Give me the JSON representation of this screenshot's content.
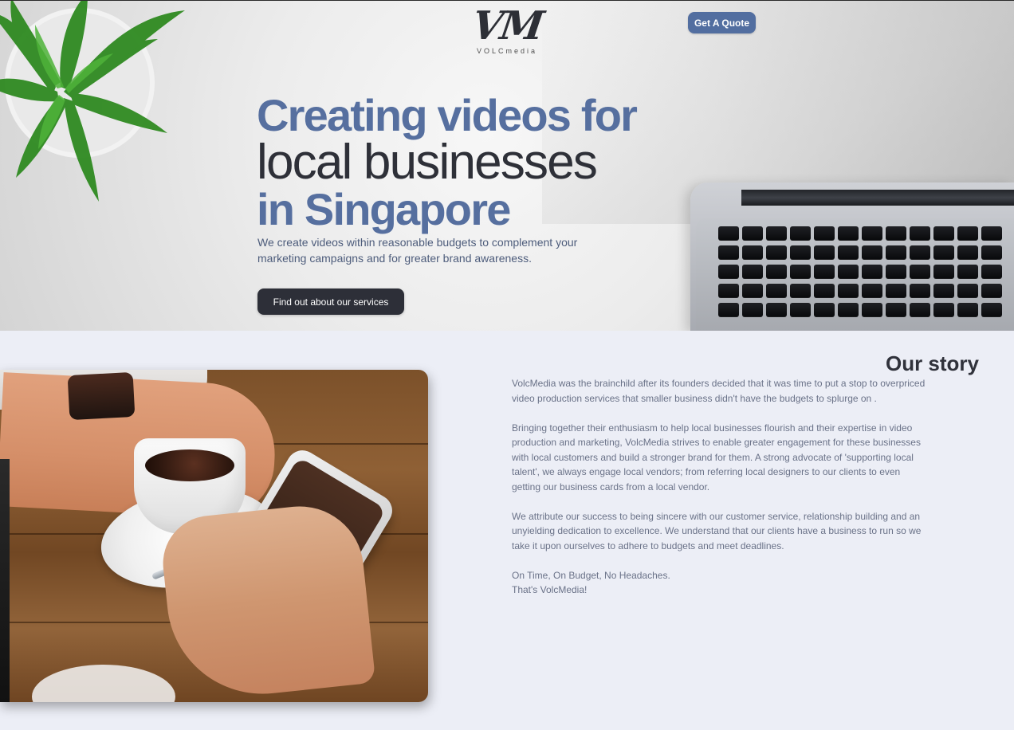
{
  "header": {
    "logo": {
      "mark": "VM",
      "word": "VOLCmedia"
    },
    "quote_button": "Get A Quote"
  },
  "hero": {
    "headline": {
      "line1": "Creating videos for",
      "line2": "local businesses",
      "line3": "in Singapore"
    },
    "subcopy": {
      "line1": "We create videos within reasonable budgets to complement your",
      "line2": "marketing campaigns and for greater brand awareness."
    },
    "services_button": "Find out about our services"
  },
  "story": {
    "title": "Our story",
    "p1": {
      "line1": "VolcMedia was the brainchild after its founders decided that it was time to put a stop to overpriced",
      "line2": "video production services that smaller business didn't have the budgets to splurge on ."
    },
    "p2": {
      "line1": "Bringing together their enthusiasm to help local businesses flourish and their expertise in video",
      "line2": "production and marketing, VolcMedia strives to enable greater engagement for these businesses",
      "line3": "with local customers and build a stronger brand for them. A strong advocate of 'supporting local",
      "line4": "talent', we always engage local vendors; from referring local designers to our clients to even",
      "line5": "getting our business cards from a local vendor."
    },
    "p3": {
      "line1": "We attribute our success to being sincere with our customer service, relationship building and an",
      "line2": "unyielding dedication to excellence. We understand that our clients have a business to run so we",
      "line3": "take it upon ourselves to adhere to budgets and meet deadlines."
    },
    "closing": {
      "line1": "On Time, On Budget, No Headaches.",
      "line2": "That's VolcMedia!"
    }
  }
}
